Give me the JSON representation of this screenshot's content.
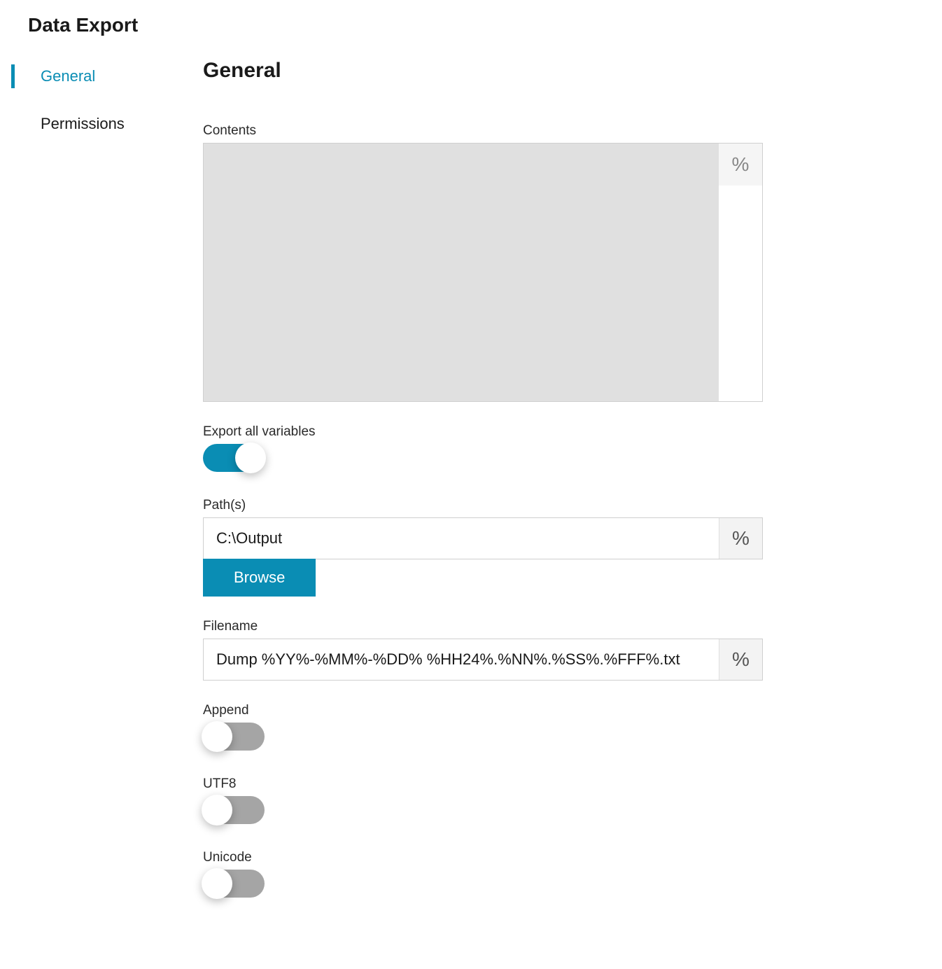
{
  "page_title": "Data Export",
  "sidebar": {
    "items": [
      {
        "label": "General",
        "active": true
      },
      {
        "label": "Permissions",
        "active": false
      }
    ]
  },
  "main": {
    "section_title": "General",
    "fields": {
      "contents": {
        "label": "Contents",
        "value": "",
        "percent_icon": "%"
      },
      "export_all": {
        "label": "Export all variables",
        "value": true
      },
      "paths": {
        "label": "Path(s)",
        "value": "C:\\Output",
        "percent_icon": "%",
        "browse_label": "Browse"
      },
      "filename": {
        "label": "Filename",
        "value": "Dump %YY%-%MM%-%DD% %HH24%.%NN%.%SS%.%FFF%.txt",
        "percent_icon": "%"
      },
      "append": {
        "label": "Append",
        "value": false
      },
      "utf8": {
        "label": "UTF8",
        "value": false
      },
      "unicode": {
        "label": "Unicode",
        "value": false
      }
    }
  }
}
